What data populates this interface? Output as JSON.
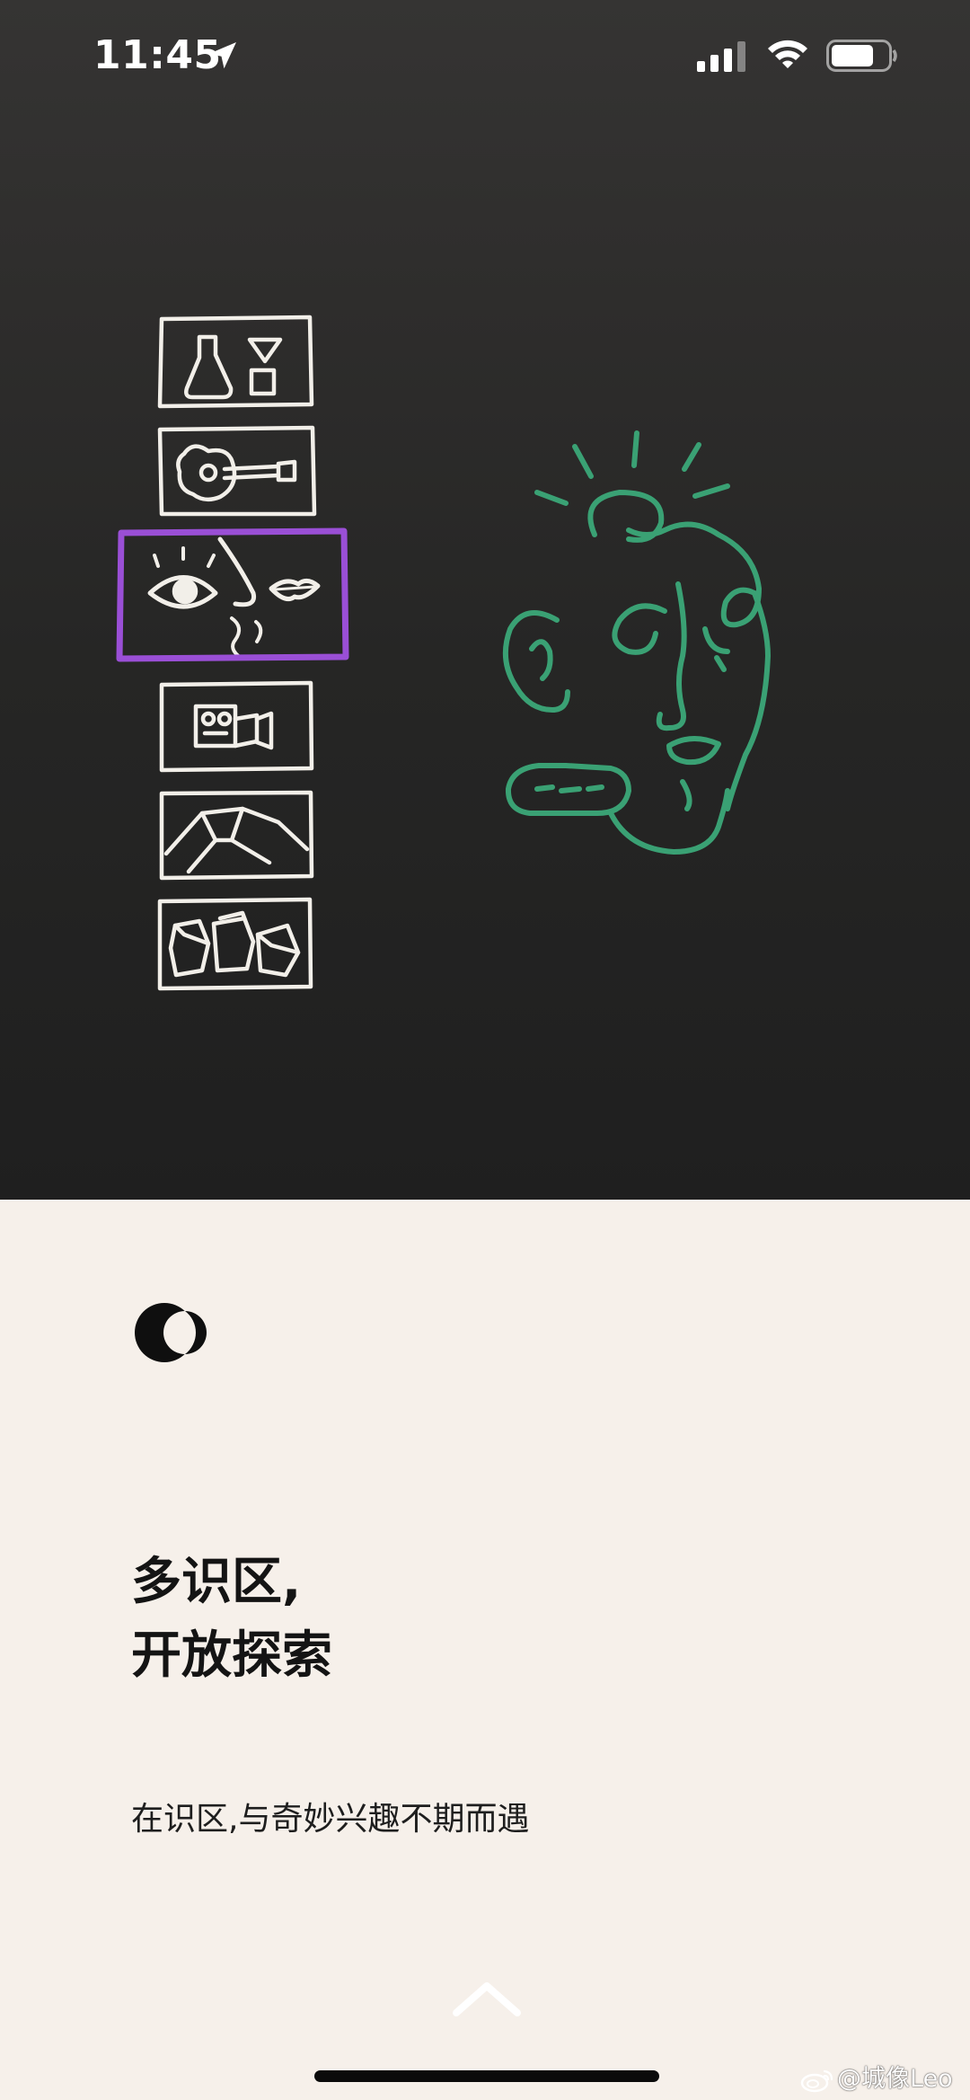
{
  "status_bar": {
    "time": "11:45",
    "icons": [
      "location-arrow-icon",
      "cellular-signal-icon",
      "wifi-icon",
      "battery-icon"
    ]
  },
  "hero": {
    "category_tiles": [
      "lab-flask-icon",
      "guitar-icon",
      "senses-eye-nose-lips-icon",
      "camera-icon",
      "mountain-landscape-icon",
      "cubes-icon"
    ],
    "selected_tile": "senses-eye-nose-lips-icon",
    "main_illustration": "green-line-face-illustration",
    "colors": {
      "tile_selected_border": "#9a4fd6",
      "face_line": "#3aa174",
      "tile_line": "#f2efe9"
    }
  },
  "onboarding": {
    "logo": "half-moon-logo-icon",
    "headline_line1": "多识区,",
    "headline_line2": "开放探索",
    "subtitle": "在识区,与奇妙兴趣不期而遇",
    "swipe_hint_icon": "chevron-up-icon"
  },
  "watermark": {
    "text": "@城像Leo",
    "icon": "weibo-icon"
  },
  "colors": {
    "background_top": "#2b2a29",
    "background_bottom": "#f6f0ea",
    "text_primary": "#141414"
  }
}
